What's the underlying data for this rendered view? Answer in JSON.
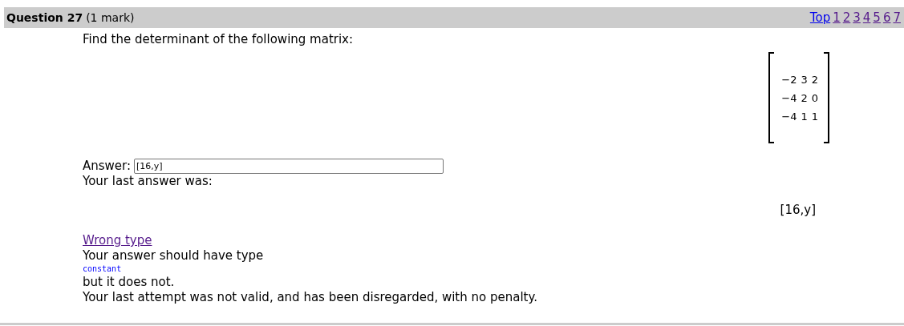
{
  "header": {
    "title": "Question 27",
    "mark": "(1 mark)",
    "links": [
      {
        "label": "Top",
        "visited": false
      },
      {
        "label": "1",
        "visited": true
      },
      {
        "label": "2",
        "visited": true
      },
      {
        "label": "3",
        "visited": true
      },
      {
        "label": "4",
        "visited": true
      },
      {
        "label": "5",
        "visited": true
      },
      {
        "label": "6",
        "visited": true
      },
      {
        "label": "7",
        "visited": true
      }
    ]
  },
  "question": "Find the determinant of the following matrix:",
  "matrix": [
    [
      "−2",
      "3",
      "2"
    ],
    [
      "−4",
      "2",
      "0"
    ],
    [
      "−4",
      "1",
      "1"
    ]
  ],
  "answer": {
    "label": "Answer:",
    "value": "[16,y]"
  },
  "last_answer": {
    "label": "Your last answer was:",
    "value": "[16,y]"
  },
  "feedback": {
    "link": "Wrong type",
    "line_1": "Your answer should have type",
    "type_name": "constant",
    "line_2": "but it does not.",
    "line_3": "Your last attempt was not valid, and has been disregarded, with no penalty."
  }
}
